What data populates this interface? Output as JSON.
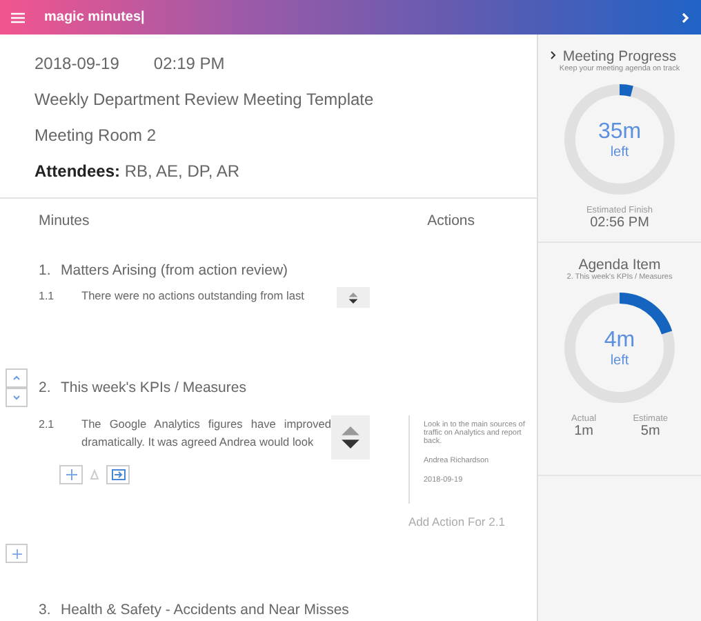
{
  "app": {
    "title": "magic minutes|"
  },
  "meeting": {
    "date": "2018-09-19",
    "time": "02:19 PM",
    "title": "Weekly Department Review Meeting Template",
    "location": "Meeting Room 2",
    "attendees_label": "Attendees:",
    "attendees": "RB, AE, DP, AR"
  },
  "columns": [
    "Minutes",
    "Actions"
  ],
  "items": [
    {
      "number": "1.",
      "title": "Matters Arising (from action review)",
      "selected": false,
      "minutes": [
        {
          "number": "1.1",
          "text": "There were no actions outstanding from last",
          "selected": false
        }
      ]
    },
    {
      "number": "2.",
      "title": "This week's KPIs / Measures",
      "selected": true,
      "minutes": [
        {
          "number": "2.1",
          "text": "The Google Analytics figures have improved dramatically. It was agreed Andrea would look",
          "selected": true,
          "actions": [
            {
              "text": "Look in to the main sources of traffic on Analytics and report back.",
              "owner": "Andrea Richardson",
              "date": "2018-09-19"
            }
          ],
          "add_action": "Add Action For 2.1"
        }
      ]
    },
    {
      "number": "3.",
      "title": "Health & Safety - Accidents and Near Misses",
      "selected": false
    }
  ],
  "progress": {
    "title": "Meeting Progress",
    "subtitle": "Keep your meeting agenda on track",
    "level": 0.04,
    "value": "35m",
    "unit": "left",
    "finish_label": "Estimated Finish",
    "finish": "02:56 PM"
  },
  "agenda": {
    "title": "Agenda Item",
    "subtitle": "2. This week's KPIs / Measures",
    "level": 0.2,
    "value": "4m",
    "unit": "left",
    "actual_label": "Actual",
    "actual": "1m",
    "estimate_label": "Estimate",
    "estimate": "5m"
  }
}
